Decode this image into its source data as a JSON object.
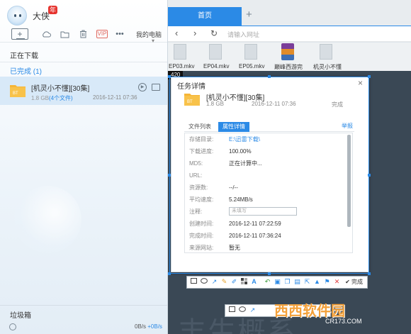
{
  "left": {
    "username": "大侠",
    "user_badge": "年",
    "toolbar": {
      "new_label": "+",
      "vip": "VIP",
      "more": "•••",
      "mypc": "我的电脑",
      "mypc_arrow": "▾"
    },
    "sections": {
      "downloading": "正在下载",
      "completed": "已完成 (1)"
    },
    "task": {
      "name": "[机灵小不懂][30集]",
      "size": "1.8 GB",
      "files": "(4个文件)",
      "time": "2016-12-11 07:36",
      "folder_label": "BT"
    },
    "trash": "垃圾箱",
    "speed_down": "0B/s",
    "speed_up": "+0B/s"
  },
  "browser": {
    "tab_label": "首页",
    "new_tab": "+",
    "nav": {
      "back": "‹",
      "forward": "›",
      "refresh": "↻"
    },
    "address_placeholder": "请输入网址",
    "files": [
      {
        "label": "EP03.mkv"
      },
      {
        "label": "EP04.mkv"
      },
      {
        "label": "EP05.mkv"
      },
      {
        "label": "巅峰西游完"
      },
      {
        "label": "机灵小不懂"
      }
    ],
    "badge": "420"
  },
  "dialog": {
    "title": "任务详情",
    "close": "×",
    "name": "[机灵小不懂][30集]",
    "size": "1.8 GB",
    "time": "2016-12-11 07:36",
    "status": "完成",
    "folder_label": "BT",
    "tabs": {
      "list": "文件列表",
      "props": "属性详情"
    },
    "report": "举报",
    "properties": [
      {
        "key": "存储目录:",
        "value": "E:\\迅雷下载\\",
        "link": true
      },
      {
        "key": "下载进度:",
        "value": "100.00%"
      },
      {
        "key": "MD5:",
        "value": "正在计算中..."
      },
      {
        "key": "URL:",
        "value": ""
      },
      {
        "key": "资源数:",
        "value": "--/--"
      },
      {
        "key": "平均速度:",
        "value": "5.24MB/s"
      },
      {
        "key": "注释:",
        "value": "",
        "placeholder": "未填写"
      },
      {
        "key": "创建时间:",
        "value": "2016-12-11 07:22:59"
      },
      {
        "key": "完成时间:",
        "value": "2016-12-11 07:36:24"
      },
      {
        "key": "来源网站:",
        "value": "暂无"
      }
    ]
  },
  "snip": {
    "done": "✔ 完成"
  },
  "background_text": "丰生概系",
  "watermark": {
    "title": "西西软件园",
    "url": "CR173.COM"
  }
}
